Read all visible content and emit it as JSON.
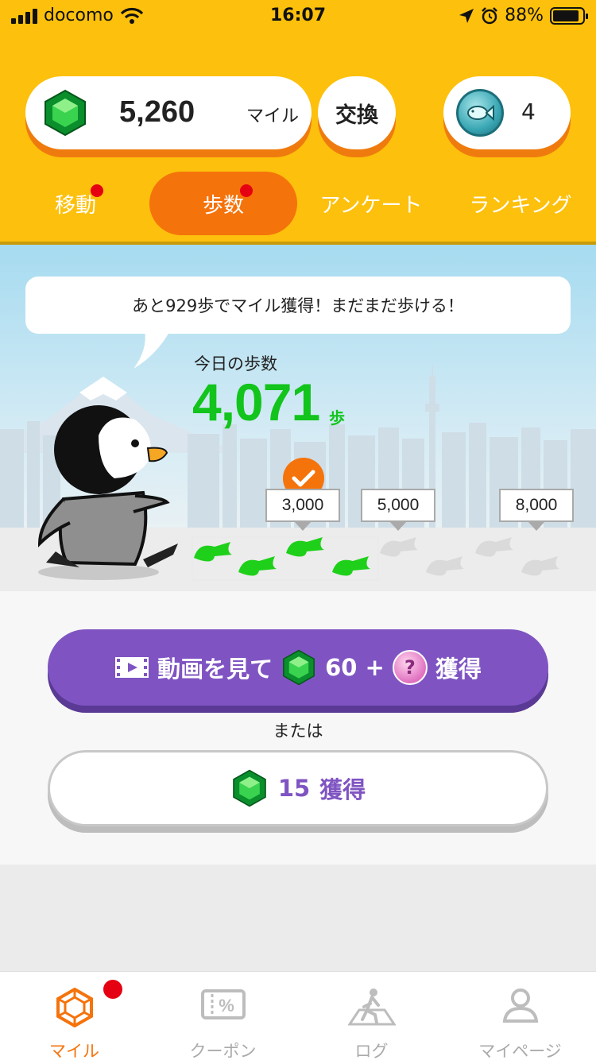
{
  "status_bar": {
    "carrier": "docomo",
    "time": "16:07",
    "battery": "88%",
    "battery_level": 0.88,
    "icons": [
      "signal-icon",
      "wifi-icon",
      "location-arrow-icon",
      "alarm-icon",
      "battery-icon"
    ]
  },
  "header": {
    "miles": {
      "value": "5,260",
      "unit": "マイル",
      "icon": "green-gem-icon"
    },
    "exchange_label": "交換",
    "coins": {
      "count": "4",
      "icon": "fish-coin-icon"
    },
    "tabs": [
      {
        "label": "移動",
        "badge": true
      },
      {
        "label": "歩数",
        "badge": true,
        "active": true
      },
      {
        "label": "アンケート",
        "badge": false
      },
      {
        "label": "ランキング",
        "badge": false
      }
    ]
  },
  "main": {
    "speech": "あと929歩でマイル獲得！まだまだ歩ける！",
    "steps_label": "今日の歩数",
    "steps_value": "4,071",
    "steps_unit": "歩",
    "milestones": [
      {
        "label": "3,000",
        "achieved": true
      },
      {
        "label": "5,000",
        "achieved": false
      },
      {
        "label": "8,000",
        "achieved": false
      }
    ],
    "video_button": {
      "label": "動画を見て",
      "amount": "60 +",
      "suffix": "獲得"
    },
    "or_label": "または",
    "get_button": {
      "amount": "15",
      "suffix": "獲得"
    }
  },
  "colors": {
    "header_bg": "#fdc00c",
    "accent_orange": "#f5730b",
    "step_green": "#12c41c",
    "purple": "#7f54c2",
    "badge_red": "#e50012"
  },
  "bottom_nav": [
    {
      "label": "マイル",
      "icon": "hexagon-gem-icon",
      "active": true,
      "badge": true
    },
    {
      "label": "クーポン",
      "icon": "coupon-percent-icon",
      "active": false
    },
    {
      "label": "ログ",
      "icon": "walking-person-icon",
      "active": false
    },
    {
      "label": "マイページ",
      "icon": "user-icon",
      "active": false
    }
  ]
}
